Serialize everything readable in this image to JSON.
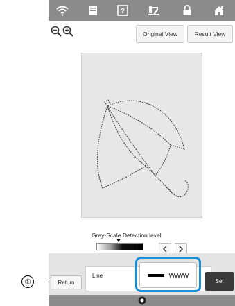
{
  "toolbar": {
    "icons": [
      "wifi-icon",
      "document-icon",
      "help-icon",
      "thread-icon",
      "lock-icon",
      "home-icon"
    ]
  },
  "view_buttons": {
    "original_label": "Original View",
    "result_label": "Result View"
  },
  "grayscale": {
    "label": "Gray-Scale Detection level",
    "prev_icon": "chevron-left-icon",
    "next_icon": "chevron-right-icon"
  },
  "bottom": {
    "return_label": "Return",
    "line_label": "Line",
    "set_label": "Set"
  },
  "callout": {
    "number": "①"
  },
  "colors": {
    "accent_highlight": "#1a8fd8",
    "topbar": "#8b8b8b",
    "set_button": "#3a3a3a"
  }
}
